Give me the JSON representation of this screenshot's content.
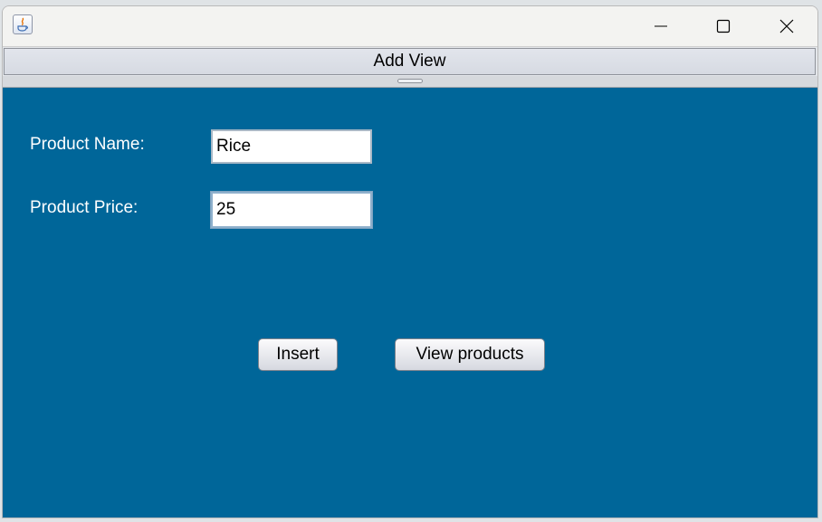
{
  "window": {
    "tab_label": "Add View"
  },
  "form": {
    "name_label": "Product Name:",
    "name_value": "Rice",
    "price_label": "Product Price:",
    "price_value": "25"
  },
  "buttons": {
    "insert_label": "Insert",
    "view_label": "View products"
  },
  "icons": {
    "app": "java-icon",
    "minimize": "minimize-icon",
    "maximize": "maximize-icon",
    "close": "close-icon"
  },
  "colors": {
    "content_bg": "#006699",
    "label_text": "#ffffff"
  }
}
